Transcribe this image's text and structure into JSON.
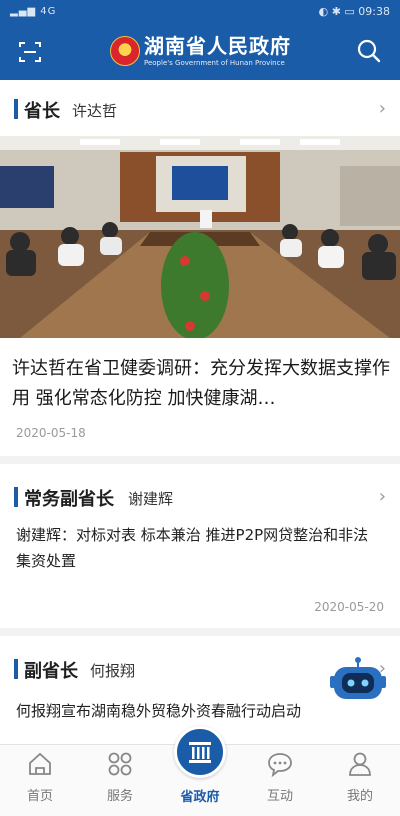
{
  "status_bar": {
    "signal": "▂▄▆ 4G",
    "right": "◐ ✱ ▭ 09:38"
  },
  "header": {
    "title": "湖南省人民政府",
    "subtitle": "People's Government of Hunan Province"
  },
  "sections": [
    {
      "role": "省长",
      "name": "许达哲",
      "headline": "许达哲在省卫健委调研：充分发挥大数据支撑作用 强化常态化防控 加快健康湖…",
      "date": "2020-05-18"
    },
    {
      "role": "常务副省长",
      "name": "谢建辉",
      "headline": "谢建辉：对标对表 标本兼治 推进P2P网贷整治和非法集资处置",
      "date": "2020-05-20"
    },
    {
      "role": "副省长",
      "name": "何报翔",
      "headline": "何报翔宣布湖南稳外贸稳外资春融行动启动"
    }
  ],
  "tabs": [
    {
      "label": "首页",
      "icon": "home-icon"
    },
    {
      "label": "服务",
      "icon": "grid-icon"
    },
    {
      "label": "省政府",
      "icon": "government-building-icon"
    },
    {
      "label": "互动",
      "icon": "chat-icon"
    },
    {
      "label": "我的",
      "icon": "profile-icon"
    }
  ],
  "colors": {
    "brand": "#1a5ca8",
    "text": "#1a1a1a",
    "muted": "#9a9a9a"
  }
}
